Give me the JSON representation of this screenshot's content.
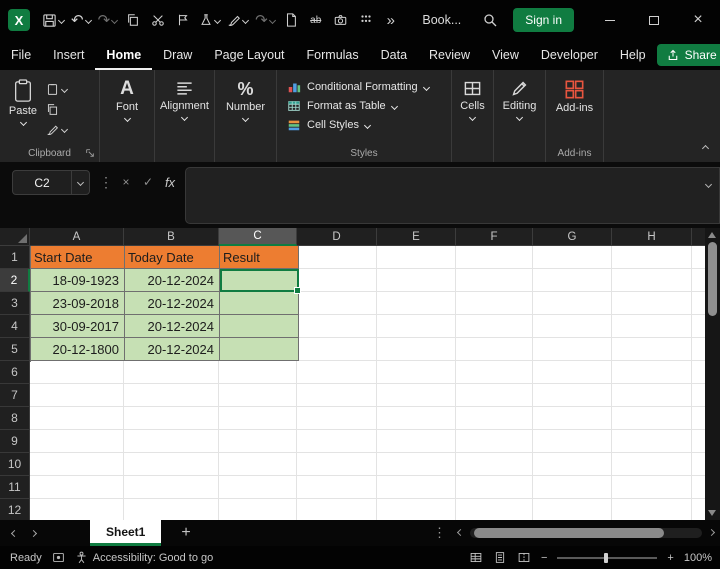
{
  "colors": {
    "accent": "#107C41",
    "header_fill": "#ED7D31",
    "data_fill": "#C6E0B4"
  },
  "titlebar": {
    "title": "Book...",
    "sign_in": "Sign in"
  },
  "glyphs": {
    "logo": "X",
    "undo": "↶",
    "redo": "↷",
    "more": "»",
    "dots": "⋮",
    "close": "×",
    "check": "✓",
    "fx": "fx",
    "percent": "%",
    "font_a": "A",
    "plus": "+",
    "minus": "−",
    "strike_sample": "ab"
  },
  "menu": {
    "tabs": [
      "File",
      "Insert",
      "Home",
      "Draw",
      "Page Layout",
      "Formulas",
      "Data",
      "Review",
      "View",
      "Developer",
      "Help"
    ],
    "active_tab": "Home",
    "share": "Share"
  },
  "ribbon": {
    "paste": "Paste",
    "font": "Font",
    "alignment": "Alignment",
    "number": "Number",
    "conditional_formatting": "Conditional Formatting",
    "format_as_table": "Format as Table",
    "cell_styles": "Cell Styles",
    "cells": "Cells",
    "editing": "Editing",
    "addins": "Add-ins",
    "group_clipboard": "Clipboard",
    "group_styles": "Styles",
    "group_addins": "Add-ins"
  },
  "formula_bar": {
    "name_box": "C2",
    "content": ""
  },
  "grid": {
    "columns": [
      "A",
      "B",
      "C",
      "D",
      "E",
      "F",
      "G",
      "H"
    ],
    "row_numbers": [
      "1",
      "2",
      "3",
      "4",
      "5",
      "6",
      "7",
      "8",
      "9",
      "10",
      "11",
      "12"
    ],
    "selected_cell": "C2",
    "cells": {
      "A1": "Start Date",
      "B1": "Today Date",
      "C1": "Result",
      "A2": "18-09-1923",
      "B2": "20-12-2024",
      "C2": "",
      "A3": "23-09-2018",
      "B3": "20-12-2024",
      "C3": "",
      "A4": "30-09-2017",
      "B4": "20-12-2024",
      "C4": "",
      "A5": "20-12-1800",
      "B5": "20-12-2024",
      "C5": ""
    }
  },
  "sheet_bar": {
    "active_tab": "Sheet1",
    "add_label": "+"
  },
  "status_bar": {
    "mode": "Ready",
    "accessibility": "Accessibility: Good to go",
    "zoom": "100%"
  }
}
